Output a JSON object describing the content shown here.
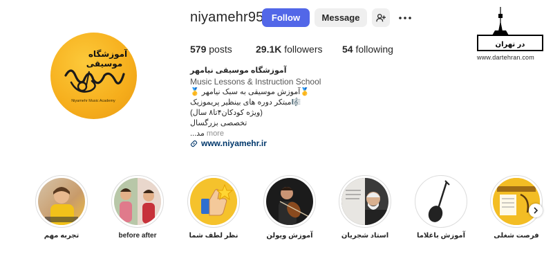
{
  "profile": {
    "username": "niyamehr95",
    "follow_label": "Follow",
    "message_label": "Message",
    "avatar_title": "آموزشگاه موسیقی",
    "avatar_caption": "Niyamehr Music Academy"
  },
  "stats": {
    "posts_count": "579",
    "posts_label": "posts",
    "followers_count": "29.1K",
    "followers_label": "followers",
    "following_count": "54",
    "following_label": "following"
  },
  "bio": {
    "name": "آموزشگاه موسیقی نیامهر",
    "category": "Music Lessons & Instruction School",
    "lines": [
      "🥇آموزش موسیقی به سبک نیامهر 🥇",
      "🎼مبتکر دوره های بینظیر پریموزیک",
      "(ویژه کودکان۴تا۸ سال)",
      "تخصصی بزرگسال"
    ],
    "truncated_line": "مد...",
    "more_label": "more",
    "link": "www.niyamehr.ir"
  },
  "watermark": {
    "logo_text": "در تهران",
    "url": "www.dartehran.com"
  },
  "highlights": [
    {
      "label": "تجربه مهم"
    },
    {
      "label": "before after"
    },
    {
      "label": "نظر لطف شما"
    },
    {
      "label": "آموزش ویولن"
    },
    {
      "label": "استاد شجریان"
    },
    {
      "label": "آموزش باغلاما"
    },
    {
      "label": "فرصت شغلی"
    }
  ],
  "colors": {
    "follow_bg": "#5267e8",
    "secondary_bg": "#efefef",
    "avatar_yellow": "#f6ae1c",
    "link": "#00376b"
  },
  "icons": {
    "add_user": "person-plus-icon",
    "more": "ellipsis-icon",
    "link": "chain-link-icon",
    "next": "chevron-right-icon"
  }
}
